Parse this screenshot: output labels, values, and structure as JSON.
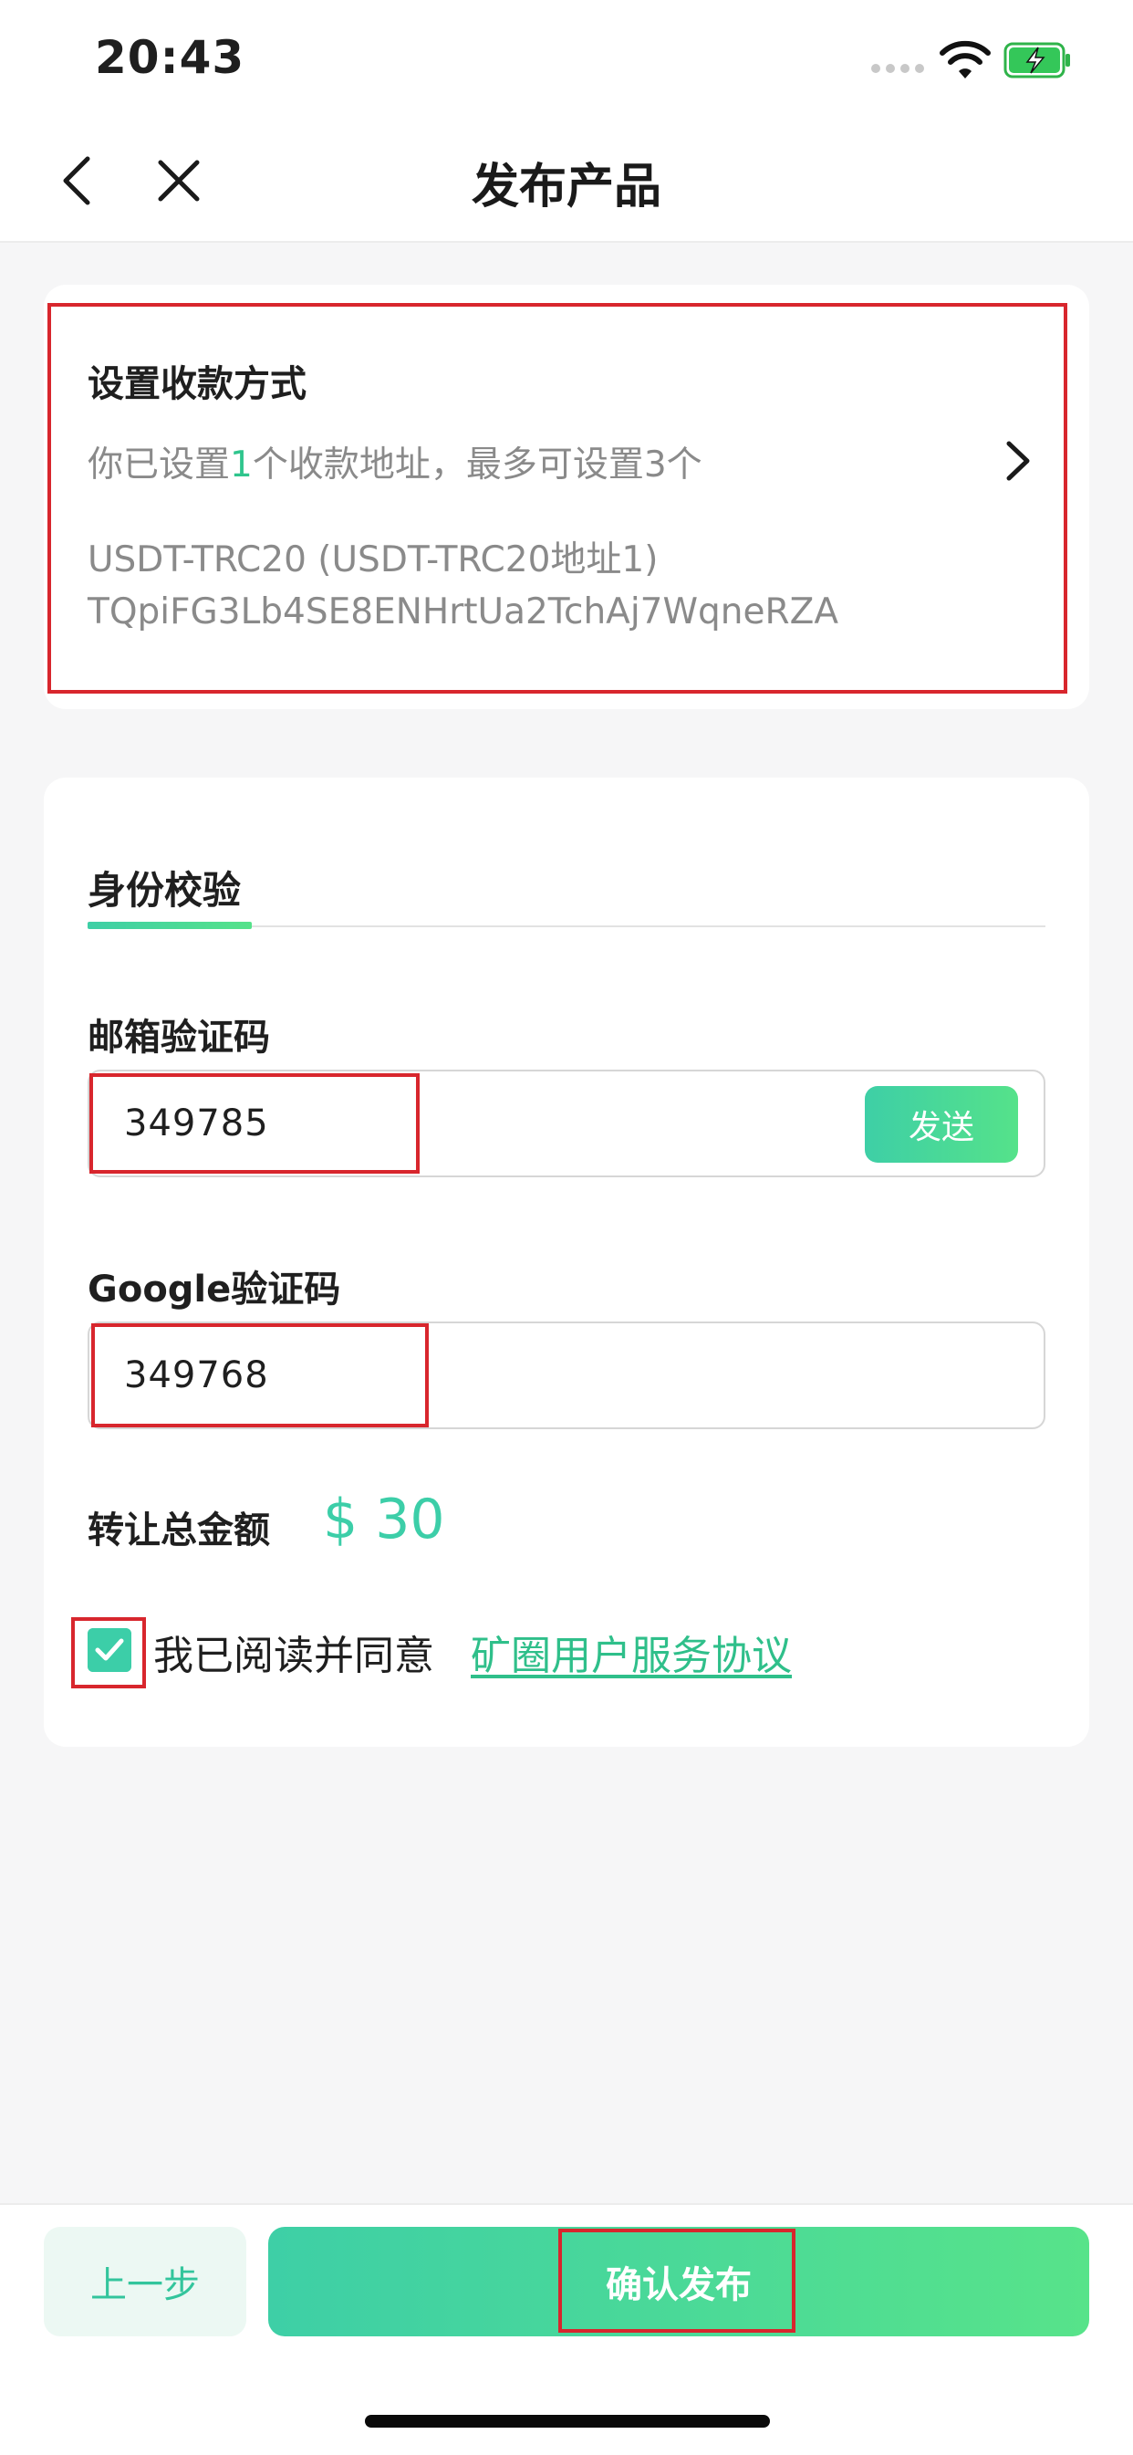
{
  "status_bar": {
    "time": "20:43"
  },
  "nav": {
    "title": "发布产品"
  },
  "payment": {
    "title": "设置收款方式",
    "summary_prefix": "你已设置",
    "summary_count": "1",
    "summary_suffix": "个收款地址，最多可设置3个",
    "address_label": "USDT-TRC20 (USDT-TRC20地址1)",
    "address_value": "TQpiFG3Lb4SE8ENHrtUa2TchAj7WqneRZA"
  },
  "verification": {
    "tab_label": "身份校验",
    "email_label": "邮箱验证码",
    "email_value": "349785",
    "send_label": "发送",
    "google_label": "Google验证码",
    "google_value": "349768",
    "amount_label": "转让总金额",
    "amount_value": "$ 30",
    "agree_text": "我已阅读并同意",
    "agree_link": "矿圈用户服务协议"
  },
  "bottom": {
    "prev_label": "上一步",
    "confirm_label": "确认发布"
  },
  "colors": {
    "accent": "#3ccea8",
    "highlight": "#d8262d"
  }
}
